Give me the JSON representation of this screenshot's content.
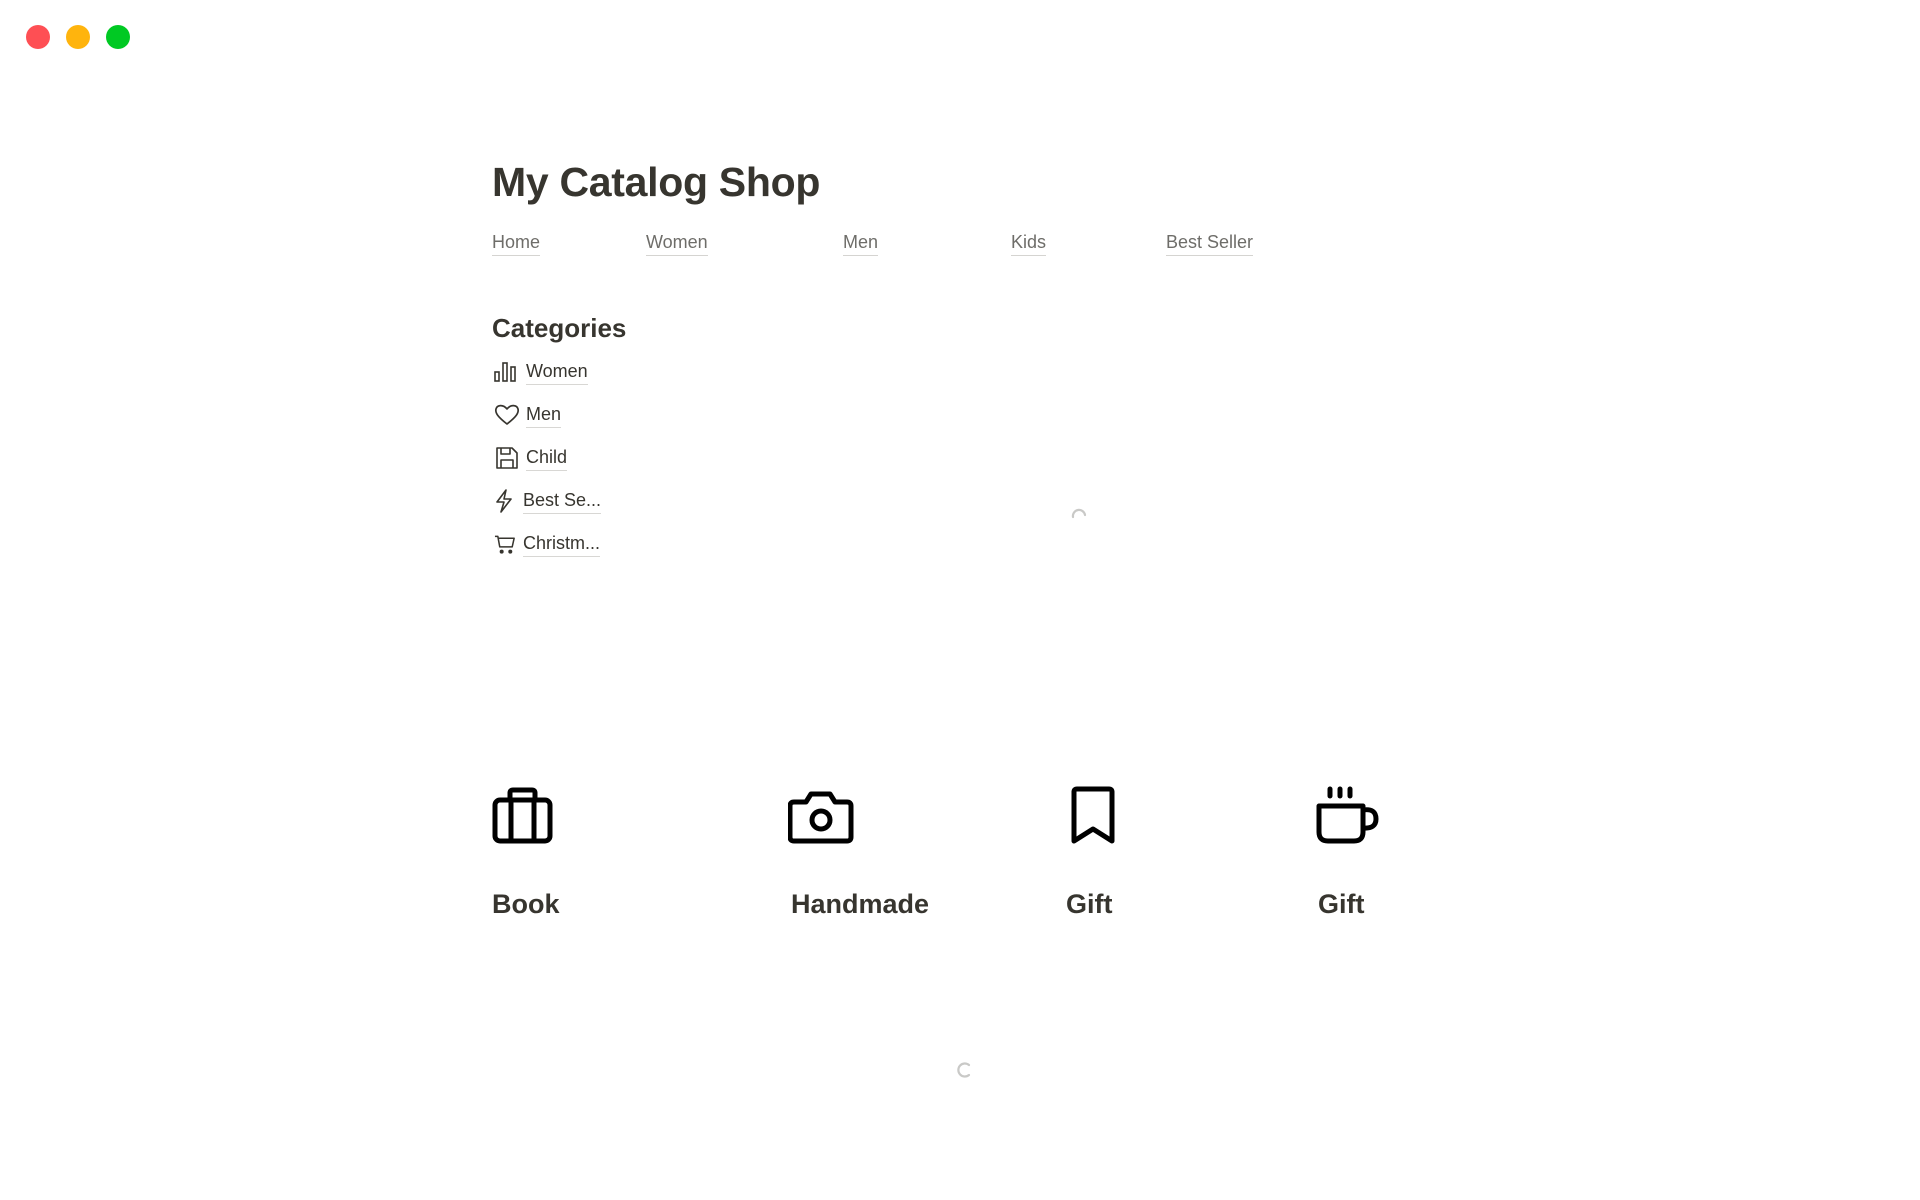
{
  "window": {
    "controls": [
      {
        "name": "close",
        "color": "#fe4f54"
      },
      {
        "name": "minimize",
        "color": "#ffb40d"
      },
      {
        "name": "maximize",
        "color": "#00c923"
      }
    ]
  },
  "page": {
    "title": "My Catalog Shop"
  },
  "nav": {
    "items": [
      {
        "label": "Home"
      },
      {
        "label": "Women"
      },
      {
        "label": "Men"
      },
      {
        "label": "Kids"
      },
      {
        "label": "Best Seller"
      }
    ]
  },
  "categories": {
    "heading": "Categories",
    "items": [
      {
        "label": "Women",
        "icon": "bar-chart-icon"
      },
      {
        "label": "Men",
        "icon": "heart-icon"
      },
      {
        "label": "Child",
        "icon": "floppy-disk-icon"
      },
      {
        "label": "Best Se...",
        "icon": "lightning-icon"
      },
      {
        "label": "Christm...",
        "icon": "shopping-cart-icon"
      }
    ]
  },
  "gallery": {
    "items": [
      {
        "label": "Book",
        "icon": "briefcase-icon"
      },
      {
        "label": "Handmade",
        "icon": "camera-icon"
      },
      {
        "label": "Gift",
        "icon": "bookmark-icon"
      },
      {
        "label": "Gift",
        "icon": "coffee-cup-icon"
      }
    ]
  },
  "status": {
    "loading_indicators": 2
  }
}
